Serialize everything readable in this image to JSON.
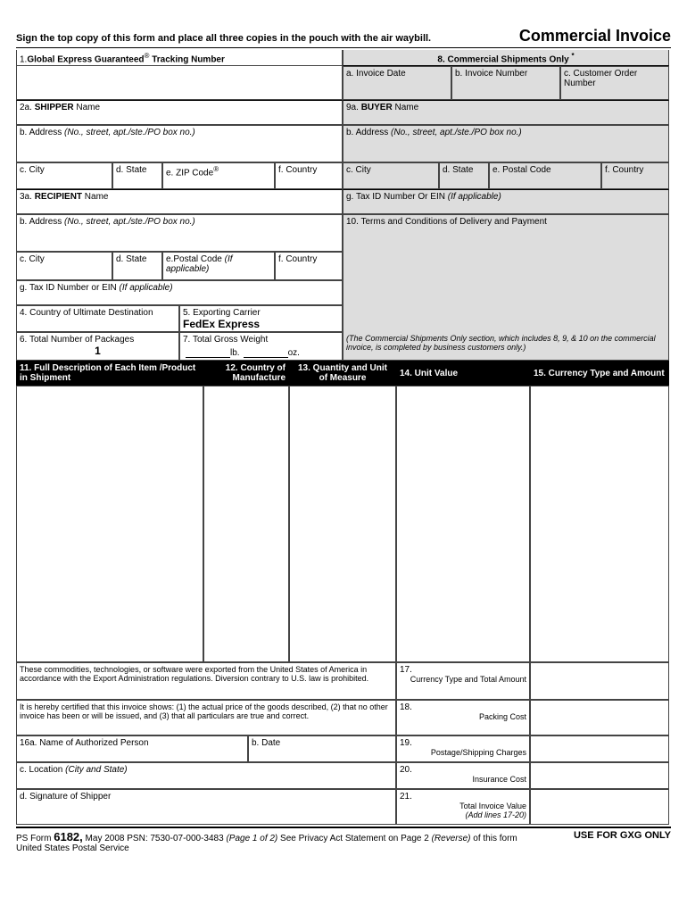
{
  "header": {
    "instruction": "Sign the top copy of this form and place all three copies in the pouch with the air waybill.",
    "title": "Commercial Invoice"
  },
  "f1": {
    "num": "1.",
    "label1": "Global Express Guaranteed",
    "reg": "®",
    "label2": " Tracking Number"
  },
  "f8": {
    "num": "8.",
    "label": "Commercial Shipments Only",
    "star": "*"
  },
  "f8a": "a. Invoice Date",
  "f8b": "b. Invoice Number",
  "f8c": "c. Customer Order Number",
  "f2a": {
    "num": "2a. ",
    "bold": "SHIPPER",
    "rest": " Name"
  },
  "f9a": {
    "num": "9a. ",
    "bold": "BUYER",
    "rest": " Name"
  },
  "f2b": {
    "label": "b. Address ",
    "italic": "(No., street, apt./ste./PO box no.)"
  },
  "f9b": {
    "label": "b. Address ",
    "italic": "(No., street, apt./ste./PO box no.)"
  },
  "f2c": "c. City",
  "f2d": "d. State",
  "f2e": {
    "label": "e. ZIP Code",
    "reg": "®"
  },
  "f2f": "f. Country",
  "f9c": "c. City",
  "f9d": "d. State",
  "f9e": "e. Postal Code",
  "f9f": "f. Country",
  "f3a": {
    "num": "3a. ",
    "bold": "RECIPIENT",
    "rest": " Name"
  },
  "f3b": {
    "label": "b. Address ",
    "italic": "(No., street, apt./ste./PO box no.)"
  },
  "f3c": "c. City",
  "f3d": "d. State",
  "f3e": {
    "label": "e.Postal Code ",
    "italic": "(If applicable)"
  },
  "f3f": "f. Country",
  "f3g": {
    "label": "g. Tax ID Number or EIN ",
    "italic": "(If applicable)"
  },
  "f9g": {
    "label": "g. Tax ID Number Or EIN ",
    "italic": "(If applicable)"
  },
  "f10": "10. Terms and Conditions of Delivery and Payment",
  "f4": "4. Country of Ultimate Destination",
  "f5": "5. Exporting Carrier",
  "f5val": "FedEx Express",
  "f6": "6. Total Number of Packages",
  "f6val": "1",
  "f7": "7. Total Gross Weight",
  "f7lb": "lb.",
  "f7oz": "oz.",
  "note": "(The Commercial Shipments Only section, which includes 8, 9, & 10 on the commercial invoice, is completed by business customers only.)",
  "col11": "11.  Full Description of Each Item /Product in Shipment",
  "col12": "12.  Country of Manufacture",
  "col13": "13.  Quantity and Unit of Measure",
  "col14": "14.  Unit Value",
  "col15": "15.  Currency Type and Amount",
  "cert1": "These commodities, technologies, or software were exported from the United States of America in accordance with the Export Administration regulations. Diversion contrary to U.S. law is prohibited.",
  "cert2": "It is hereby certified that this invoice shows: (1) the actual price of the goods described, (2) that no other invoice has been or will be issued, and (3) that all particulars are true and correct.",
  "f16a": "16a. Name of Authorized Person",
  "f16b": "b. Date",
  "f16c": {
    "label": "c. Location ",
    "italic": "(City and State)"
  },
  "f16d": "d. Signature of Shipper",
  "f17n": "17.",
  "f17": "Currency Type and Total Amount",
  "f18n": "18.",
  "f18": "Packing Cost",
  "f19n": "19.",
  "f19": "Postage/Shipping Charges",
  "f20n": "20.",
  "f20": "Insurance Cost",
  "f21n": "21.",
  "f21a": "Total Invoice Value",
  "f21b": "(Add lines 17-20)",
  "footer": {
    "form": "PS Form ",
    "formnum": "6182,",
    "date": " May 2008  PSN: 7530-07-000-3483 ",
    "page": "(Page 1 of 2)",
    "rest": "  See Privacy Act Statement on Page 2 ",
    "rev": "(Reverse)",
    "rest2": " of this form",
    "org": "United States Postal Service",
    "use": "USE FOR GXG ONLY"
  }
}
